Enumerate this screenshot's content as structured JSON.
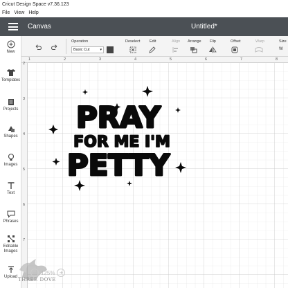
{
  "window": {
    "title": "Cricut Design Space  v7.36.123"
  },
  "menubar": {
    "items": [
      "File",
      "View",
      "Help"
    ]
  },
  "appbar": {
    "title": "Canvas",
    "document": "Untitled*"
  },
  "sidebar": {
    "items": [
      {
        "label": "New",
        "icon": "plus-circle-icon"
      },
      {
        "label": "Templates",
        "icon": "shirt-icon"
      },
      {
        "label": "Projects",
        "icon": "folder-icon"
      },
      {
        "label": "Shapes",
        "icon": "shapes-icon"
      },
      {
        "label": "Images",
        "icon": "lightbulb-icon"
      },
      {
        "label": "Text",
        "icon": "text-icon"
      },
      {
        "label": "Phrases",
        "icon": "speech-bubble-icon"
      },
      {
        "label": "Editable Images",
        "icon": "editable-images-icon"
      },
      {
        "label": "Upload",
        "icon": "upload-icon"
      }
    ]
  },
  "toolbar": {
    "operation_label": "Operation",
    "operation_value": "Basic Cut",
    "deselect_label": "Deselect",
    "edit_label": "Edit",
    "align_label": "Align",
    "arrange_label": "Arrange",
    "flip_label": "Flip",
    "offset_label": "Offset",
    "warp_label": "Warp",
    "size_label": "Size",
    "swatch_color": "#444444"
  },
  "ruler": {
    "top": [
      "2",
      "3",
      "4",
      "5",
      "6",
      "7",
      "8"
    ],
    "left": [
      "2",
      "3",
      "4",
      "5",
      "6",
      "7"
    ]
  },
  "design": {
    "line1": "PRAY",
    "line2": "FOR ME I'M",
    "line3": "PETTY"
  },
  "zoom": {
    "value": "125%",
    "minus": "−",
    "plus": "+"
  },
  "watermark": {
    "text": "THREE DOVE"
  }
}
